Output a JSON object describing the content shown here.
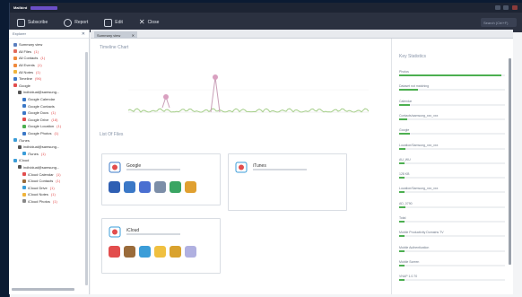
{
  "titlebar": {
    "app": "Mailbird",
    "document": "",
    "icon_names": [
      "minimize-icon",
      "maximize-icon",
      "close-icon"
    ]
  },
  "toolbar": {
    "buttons": [
      {
        "label": "Subscribe",
        "icon": "subscribe-icon"
      },
      {
        "label": "Report",
        "icon": "report-icon"
      },
      {
        "label": "Edit",
        "icon": "edit-icon"
      },
      {
        "label": "Close",
        "icon": "close-icon"
      }
    ],
    "search_placeholder": "Search (Ctrl+F)"
  },
  "sidebar": {
    "title": "Explorer",
    "items": [
      {
        "label": "Summary view",
        "color": "#5b7fbf",
        "indent": 0,
        "count": ""
      },
      {
        "label": "All Files",
        "color": "#e26b5b",
        "indent": 0,
        "count": "(1)"
      },
      {
        "label": "All Contacts",
        "color": "#f08a3c",
        "indent": 0,
        "count": "(1)"
      },
      {
        "label": "All Events",
        "color": "#f08a3c",
        "indent": 0,
        "count": "(1)"
      },
      {
        "label": "All Notes",
        "color": "#f0b43c",
        "indent": 0,
        "count": "(1)"
      },
      {
        "label": "Timeline",
        "color": "#3b78c7",
        "indent": 0,
        "count": "(96)"
      },
      {
        "label": "Google",
        "color": "#e24d4d",
        "indent": 0,
        "count": ""
      },
      {
        "label": "individual@samsung...",
        "color": "#555555",
        "indent": 1,
        "count": ""
      },
      {
        "label": "Google Calendar",
        "color": "#3b78c7",
        "indent": 2,
        "count": ""
      },
      {
        "label": "Google Contacts",
        "color": "#3b78c7",
        "indent": 2,
        "count": ""
      },
      {
        "label": "Google Docs",
        "color": "#3b78c7",
        "indent": 2,
        "count": "(1)"
      },
      {
        "label": "Google Drive",
        "color": "#e24d4d",
        "indent": 2,
        "count": "(18)"
      },
      {
        "label": "Google Location",
        "color": "#4caf50",
        "indent": 2,
        "count": "(1)"
      },
      {
        "label": "Google Photos",
        "color": "#3b78c7",
        "indent": 2,
        "count": "(1)"
      },
      {
        "label": "iTunes",
        "color": "#3b9dd8",
        "indent": 0,
        "count": ""
      },
      {
        "label": "individual@samsung...",
        "color": "#555555",
        "indent": 1,
        "count": ""
      },
      {
        "label": "iTunes",
        "color": "#3b9dd8",
        "indent": 2,
        "count": "(1)"
      },
      {
        "label": "iCloud",
        "color": "#3b9dd8",
        "indent": 0,
        "count": ""
      },
      {
        "label": "individual@samsung...",
        "color": "#555555",
        "indent": 1,
        "count": ""
      },
      {
        "label": "iCloud Calendar",
        "color": "#e24d4d",
        "indent": 2,
        "count": "(1)"
      },
      {
        "label": "iCloud Contacts",
        "color": "#9a6b3a",
        "indent": 2,
        "count": "(1)"
      },
      {
        "label": "iCloud Drive",
        "color": "#3b9dd8",
        "indent": 2,
        "count": "(1)"
      },
      {
        "label": "iCloud Notes",
        "color": "#f0b43c",
        "indent": 2,
        "count": "(1)"
      },
      {
        "label": "iCloud Photos",
        "color": "#888888",
        "indent": 2,
        "count": "(1)"
      }
    ]
  },
  "tabs": [
    {
      "label": "Summary view"
    }
  ],
  "main": {
    "chart_title": "Timeline Chart",
    "accounts_title": "List Of Files",
    "accounts": [
      {
        "name": "Google",
        "logo_color": "#3b78c7",
        "apps": [
          {
            "icon": "calendar-icon",
            "color": "#2f5fb3"
          },
          {
            "icon": "date-icon",
            "color": "#3b78c7"
          },
          {
            "icon": "docs-icon",
            "color": "#4a6fd1"
          },
          {
            "icon": "drive-icon",
            "color": "#7c8ea8"
          },
          {
            "icon": "location-icon",
            "color": "#3aa563"
          },
          {
            "icon": "photos-icon",
            "color": "#e0a030"
          }
        ]
      },
      {
        "name": "iTunes",
        "logo_color": "#3b9dd8",
        "apps": []
      },
      {
        "name": "iCloud",
        "logo_color": "#3b9dd8",
        "apps": [
          {
            "icon": "calendar-icon",
            "color": "#e24d4d"
          },
          {
            "icon": "contacts-icon",
            "color": "#9a6b3a"
          },
          {
            "icon": "drive-icon",
            "color": "#3b9dd8"
          },
          {
            "icon": "notes-icon",
            "color": "#f0c040"
          },
          {
            "icon": "photos-icon",
            "color": "#d9a22e"
          },
          {
            "icon": "location-icon",
            "color": "#b0b0e0"
          }
        ]
      }
    ]
  },
  "stats": {
    "title": "Key Statistics",
    "rows": [
      {
        "label": "Photos",
        "value": 0.97
      },
      {
        "label": "Dataset not matching",
        "value": 0.18
      },
      {
        "label": "Calendar",
        "value": 0.1
      },
      {
        "label": "Contacts/samsung_xxx_xxx",
        "value": 0.08
      },
      {
        "label": "Google",
        "value": 0.1
      },
      {
        "label": "Location/Samsung_xxx_xxx",
        "value": 0.06
      },
      {
        "label": "AU_WU",
        "value": 0.05
      },
      {
        "label": "128 KB",
        "value": 0.05
      },
      {
        "label": "Location/Samsung_xxx_xxx",
        "value": 0.05
      },
      {
        "label": "AD_0790",
        "value": 0.06
      },
      {
        "label": "Total",
        "value": 0.05
      },
      {
        "label": "Mobile Productivity Domains TV",
        "value": 0.05
      },
      {
        "label": "Mobile Authentication",
        "value": 0.05
      },
      {
        "label": "Mobile Screen",
        "value": 0.05
      },
      {
        "label": "VNAP 1.0.70",
        "value": 0.05
      }
    ]
  }
}
